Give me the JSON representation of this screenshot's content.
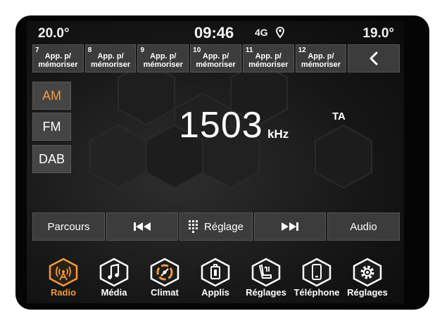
{
  "status": {
    "temp_left": "20.0°",
    "clock": "09:46",
    "network": "4G",
    "temp_right": "19.0°"
  },
  "presets": [
    {
      "num": "7",
      "label": "App. p/\nmémoriser"
    },
    {
      "num": "8",
      "label": "App. p/\nmémoriser"
    },
    {
      "num": "9",
      "label": "App. p/\nmémoriser"
    },
    {
      "num": "10",
      "label": "App. p/\nmémoriser"
    },
    {
      "num": "11",
      "label": "App. p/\nmémoriser"
    },
    {
      "num": "12",
      "label": "App. p/\nmémoriser"
    }
  ],
  "bands": {
    "am": "AM",
    "fm": "FM",
    "dab": "DAB"
  },
  "tuner": {
    "frequency": "1503",
    "unit": "kHz",
    "ta": "TA"
  },
  "controls": {
    "parcours": "Parcours",
    "reglage": "Réglage",
    "audio": "Audio"
  },
  "nav": {
    "radio": "Radio",
    "media": "Média",
    "climat": "Climat",
    "applis": "Applis",
    "reglages_seat": "Réglages",
    "telephone": "Téléphone",
    "reglages": "Réglages"
  },
  "colors": {
    "accent": "#f39a3d",
    "button": "#3c3c3c",
    "background": "#161616"
  }
}
